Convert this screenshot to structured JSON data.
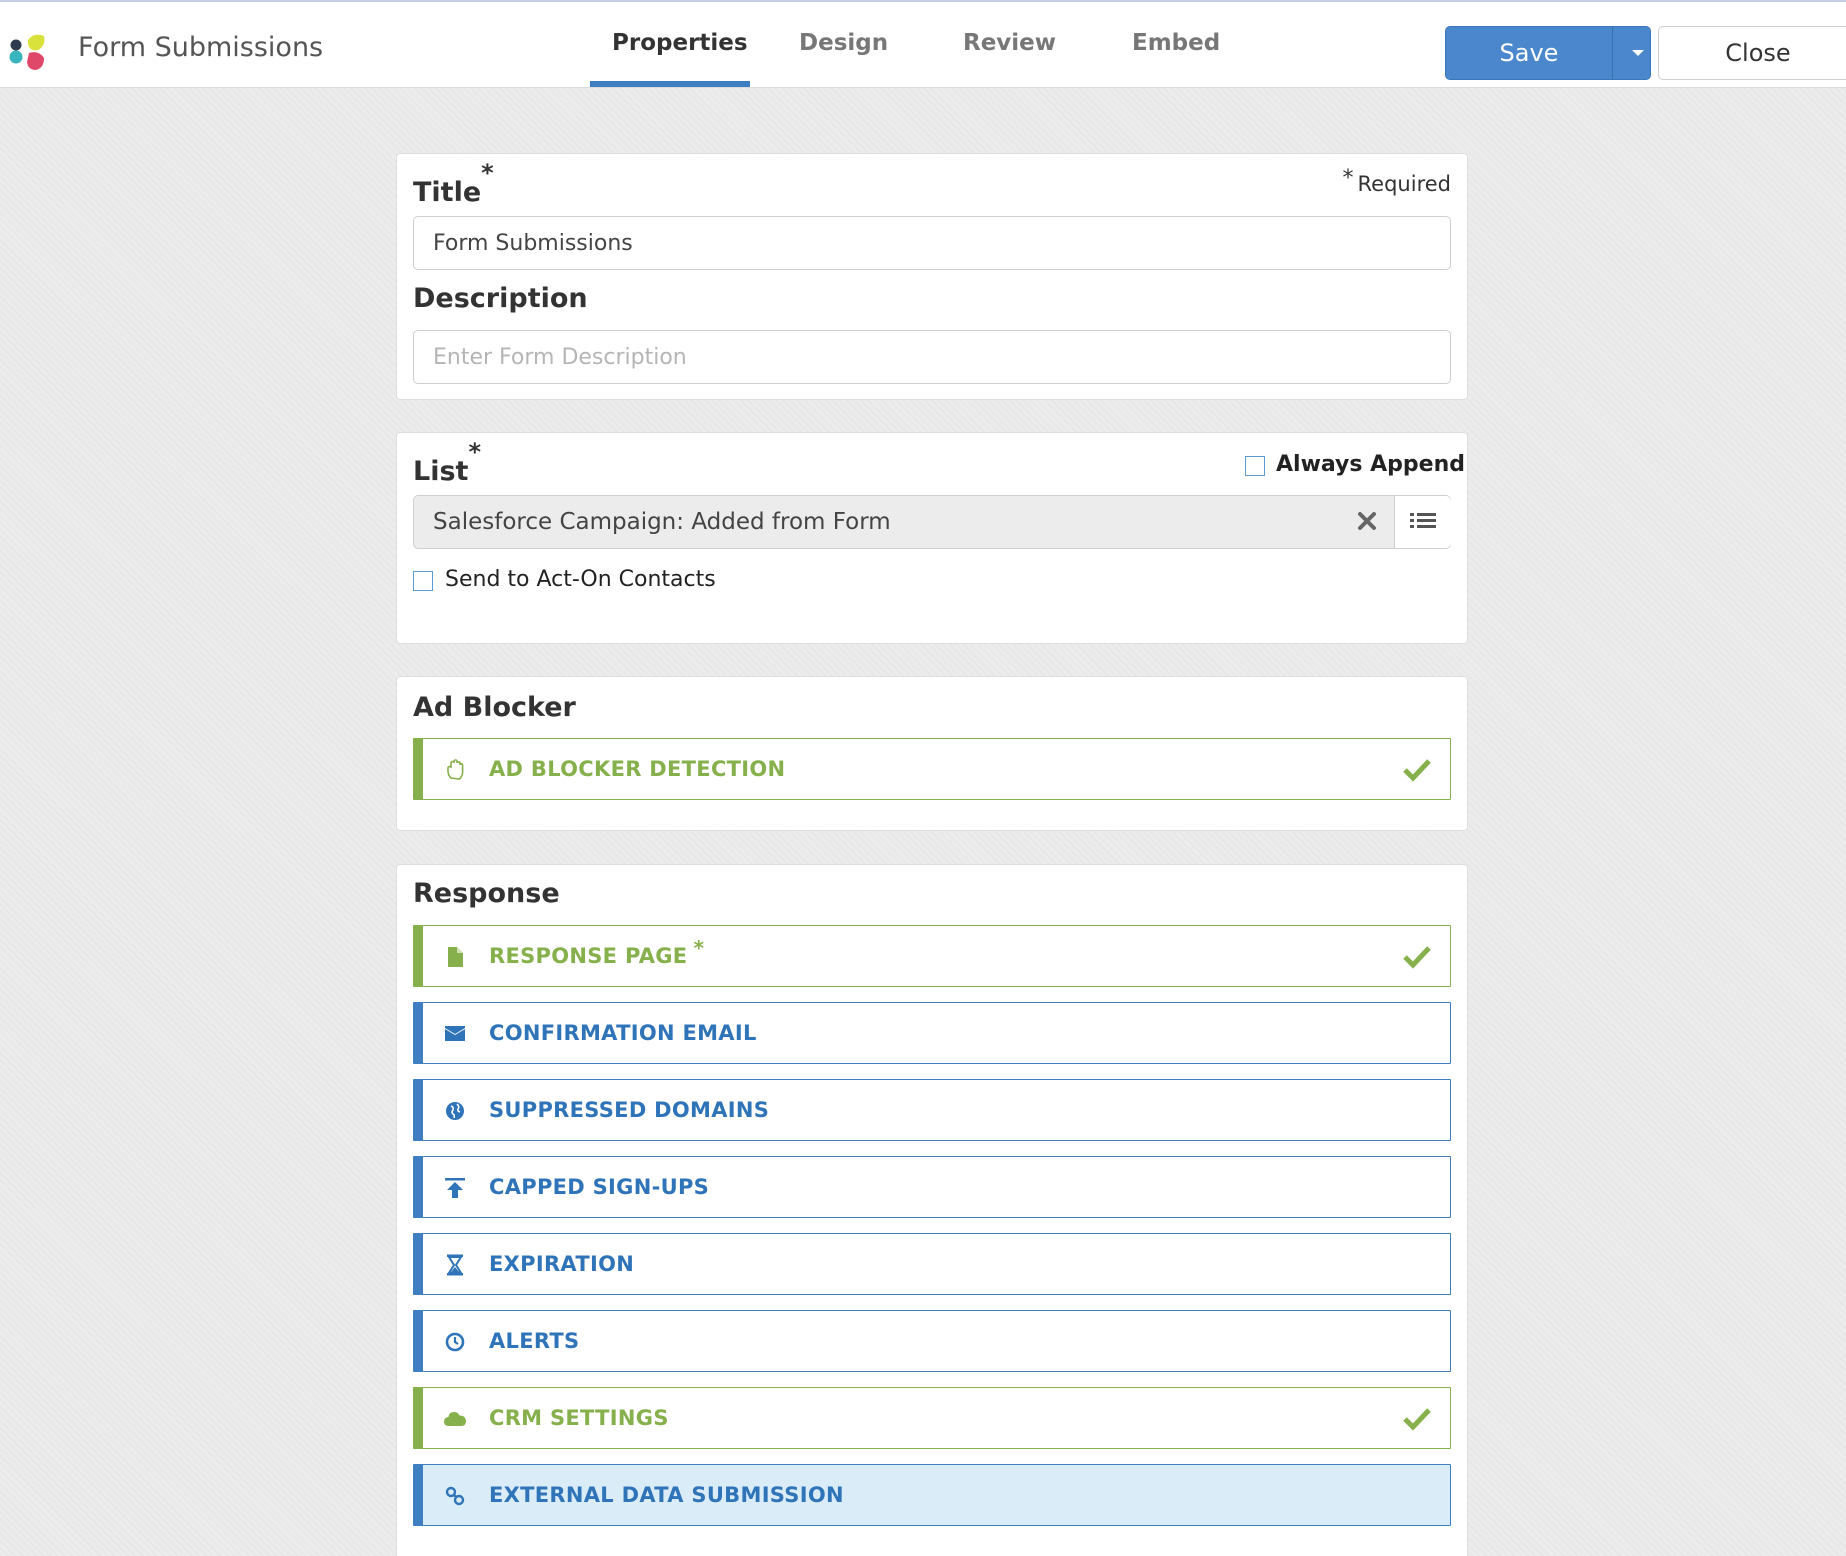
{
  "header": {
    "app_title": "Form Submissions",
    "tabs": [
      {
        "label": "Properties",
        "active": true
      },
      {
        "label": "Design",
        "active": false
      },
      {
        "label": "Review",
        "active": false
      },
      {
        "label": "Embed",
        "active": false
      }
    ],
    "save_label": "Save",
    "close_label": "Close"
  },
  "title_card": {
    "title_label": "Title",
    "required_star": "*",
    "required_note": "Required",
    "title_value": "Form Submissions",
    "description_label": "Description",
    "description_placeholder": "Enter Form Description"
  },
  "list_card": {
    "list_label": "List",
    "required_star": "*",
    "always_append_label": "Always Append",
    "always_append_checked": false,
    "selected_list": "Salesforce Campaign: Added from Form",
    "send_to_contacts_label": "Send to Act-On Contacts",
    "send_to_contacts_checked": false
  },
  "ad_blocker_card": {
    "title": "Ad Blocker",
    "rows": [
      {
        "label": "AD BLOCKER DETECTION",
        "icon": "hand-icon",
        "status": "complete"
      }
    ]
  },
  "response_card": {
    "title": "Response",
    "required_star": "*",
    "rows": [
      {
        "label": "RESPONSE PAGE",
        "icon": "file-icon",
        "status": "complete",
        "required": true
      },
      {
        "label": "CONFIRMATION EMAIL",
        "icon": "envelope-icon",
        "status": "incomplete"
      },
      {
        "label": "SUPPRESSED DOMAINS",
        "icon": "globe-icon",
        "status": "incomplete"
      },
      {
        "label": "CAPPED SIGN-UPS",
        "icon": "arrow-up-icon",
        "status": "incomplete"
      },
      {
        "label": "EXPIRATION",
        "icon": "hourglass-icon",
        "status": "incomplete"
      },
      {
        "label": "ALERTS",
        "icon": "clock-icon",
        "status": "incomplete"
      },
      {
        "label": "CRM SETTINGS",
        "icon": "cloud-icon",
        "status": "complete"
      },
      {
        "label": "EXTERNAL DATA SUBMISSION",
        "icon": "link-icon",
        "status": "selected"
      }
    ]
  },
  "colors": {
    "accent_blue": "#3f7ec0",
    "complete_green": "#86b04b",
    "selected_row_bg": "#d9ecf8",
    "save_button": "#4a87cc"
  }
}
